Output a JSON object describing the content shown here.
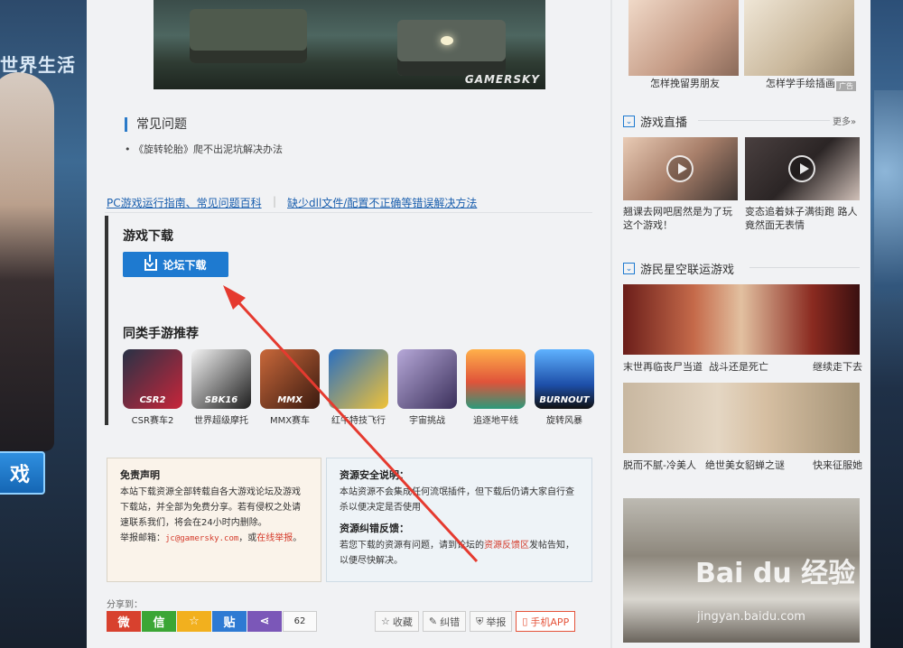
{
  "background": {
    "left_banner_small": "",
    "left_banner_title": "世界生活",
    "left_button_text": "戏"
  },
  "top_image": {
    "watermark": "GAMERSKY"
  },
  "faq": {
    "title": "常见问题",
    "items": [
      "《旋转轮胎》爬不出泥坑解决办法"
    ]
  },
  "help_links": [
    "PC游戏运行指南、常见问题百科",
    "缺少dll文件/配置不正确等错误解决方法"
  ],
  "download": {
    "title": "游戏下载",
    "button_label": "论坛下载",
    "similar_title": "同类手游推荐",
    "apps": [
      {
        "name": "CSR赛车2",
        "thumb_text": "CSR2",
        "color": "#1c2230"
      },
      {
        "name": "世界超级摩托",
        "thumb_text": "SBK16",
        "color": "#e9e9e9"
      },
      {
        "name": "MMX赛车",
        "thumb_text": "MMX",
        "color": "#5a2a1a"
      },
      {
        "name": "红牛特技飞行",
        "thumb_text": "",
        "color": "#2a6fc0"
      },
      {
        "name": "宇宙挑战",
        "thumb_text": "",
        "color": "#6a5c9a"
      },
      {
        "name": "追逐地平线",
        "thumb_text": "",
        "color": "#e07a3a"
      },
      {
        "name": "旋转风暴",
        "thumb_text": "BURNOUT",
        "color": "#2d6fd6"
      }
    ]
  },
  "disclaimer": {
    "title": "免责声明",
    "body": "本站下载资源全部转载自各大游戏论坛及游戏下载站，并全部为免费分享。若有侵权之处请速联系我们，将会在24小时内删除。",
    "email_label": "举报邮箱：",
    "email": "jc@gamersky.com",
    "email_sep": "，或",
    "report_link": "在线举报",
    "period": "。"
  },
  "security": {
    "title": "资源安全说明：",
    "body": "本站资源不会集成任何流氓插件，但下载后仍请大家自行查杀以便决定是否使用",
    "feedback_title": "资源纠错反馈：",
    "feedback_pre": "若您下载的资源有问题，请到论坛的",
    "feedback_link": "资源反馈区",
    "feedback_post": "发帖告知，以便尽快解决。"
  },
  "share": {
    "label": "分享到：",
    "count": "62",
    "buttons": [
      {
        "icon": "weibo-icon",
        "glyph": "微",
        "color": "#d8412e"
      },
      {
        "icon": "wechat-icon",
        "glyph": "信",
        "color": "#3ba635"
      },
      {
        "icon": "qzone-icon",
        "glyph": "☆",
        "color": "#f2b01e"
      },
      {
        "icon": "tieba-icon",
        "glyph": "贴",
        "color": "#2e7ad3"
      },
      {
        "icon": "share-icon",
        "glyph": "⋖",
        "color": "#7b57b8"
      }
    ],
    "tools": {
      "favorite": "收藏",
      "correct": "纠错",
      "report": "举报",
      "app": "手机APP"
    }
  },
  "sidebar": {
    "top_items": [
      {
        "caption": "怎样挽留男朋友"
      },
      {
        "caption": "怎样学手绘插画"
      }
    ],
    "ad_label": "广告",
    "live": {
      "title": "游戏直播",
      "more": "更多»",
      "items": [
        {
          "caption": "翘课去网吧居然是为了玩这个游戏！"
        },
        {
          "caption": "变态追着妹子满街跑 路人竟然面无表情"
        }
      ]
    },
    "star": {
      "title": "游民星空联运游戏",
      "items": [
        {
          "left": "末世再临丧尸当道",
          "mid": "战斗还是死亡",
          "right": "继续走下去"
        },
        {
          "left": "脱而不腻-冷美人",
          "mid": "绝世美女貂蝉之谜",
          "right": "快来征服她"
        }
      ]
    }
  },
  "watermark": {
    "main": "Bai du 经验",
    "sub": "jingyan.baidu.com"
  }
}
